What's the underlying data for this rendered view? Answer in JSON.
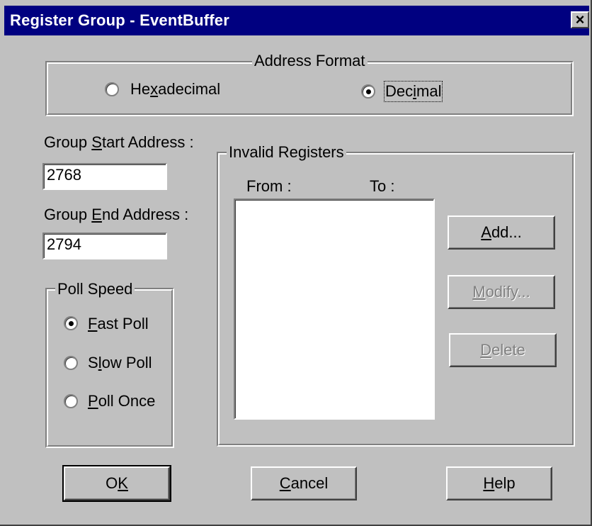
{
  "dialog": {
    "title": "Register Group - EventBuffer",
    "close_label": "×"
  },
  "address_format": {
    "legend": "Address Format",
    "options": [
      {
        "label": "Hexadecimal",
        "accel": "x",
        "checked": false
      },
      {
        "label": "Decimal",
        "accel": "i",
        "checked": true
      }
    ]
  },
  "start_address": {
    "label_pre": "Group ",
    "label_accel": "S",
    "label_post": "tart Address :",
    "value": "2768"
  },
  "end_address": {
    "label_pre": "Group ",
    "label_accel": "E",
    "label_post": "nd Address :",
    "value": "2794"
  },
  "poll_speed": {
    "legend": "Poll Speed",
    "options": [
      {
        "accel": "F",
        "rest": "ast Poll",
        "checked": true
      },
      {
        "pre": "S",
        "accel": "l",
        "rest": "ow Poll",
        "checked": false
      },
      {
        "accel": "P",
        "rest": "oll Once",
        "checked": false
      }
    ]
  },
  "invalid_registers": {
    "legend": "Invalid Registers",
    "col_from": "From :",
    "col_to": "To :",
    "items": []
  },
  "buttons": {
    "add": {
      "accel": "A",
      "rest": "dd..."
    },
    "modify": {
      "accel": "M",
      "rest": "odify..."
    },
    "delete": {
      "accel": "D",
      "rest": "elete"
    },
    "ok": {
      "pre": "O",
      "accel": "K"
    },
    "cancel": {
      "accel": "C",
      "rest": "ancel"
    },
    "help": {
      "accel": "H",
      "rest": "elp"
    }
  }
}
